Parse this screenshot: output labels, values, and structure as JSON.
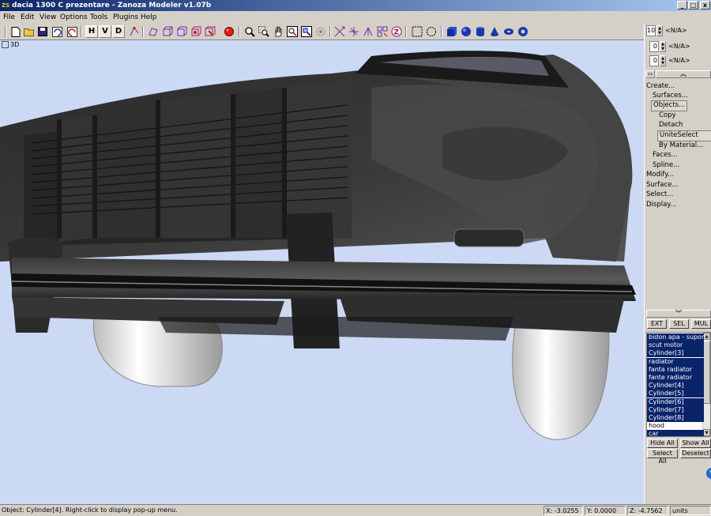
{
  "window": {
    "title": "dacia 1300 C prezentare - Zanoza Modeler v1.07b",
    "logo": "ZS",
    "controls": [
      "_",
      "□",
      "x"
    ]
  },
  "menu": [
    "File",
    "Edit",
    "View",
    "Options",
    "Tools",
    "Plugins",
    "Help"
  ],
  "toolbar": {
    "view_buttons": [
      "H",
      "V",
      "D"
    ]
  },
  "viewport": {
    "label": "3D",
    "background": "#ccd9f4"
  },
  "right_panel": {
    "spinners": [
      {
        "value": "10",
        "label": "<N/A>"
      },
      {
        "value": "0",
        "label": "<N/A>"
      },
      {
        "value": "0",
        "label": "<N/A>"
      }
    ],
    "tree": {
      "create": "Create...",
      "surfaces": "Surfaces...",
      "objects": "Objects...",
      "copy": "Copy",
      "detach": "Detach",
      "unite_select": "UniteSelect",
      "by_material": "By Material...",
      "faces": "Faces...",
      "spline": "Spline...",
      "modify": "Modify...",
      "surface": "Surface...",
      "select": "Select...",
      "display": "Display..."
    },
    "mode_buttons": [
      "EXT",
      "SEL",
      "MUL"
    ],
    "object_list": [
      {
        "name": "bidon apa - suport",
        "selected": true
      },
      {
        "name": "scut motor",
        "selected": true
      },
      {
        "name": "Cylinder[3]",
        "selected": true
      },
      {
        "name": "radiator",
        "selected": true
      },
      {
        "name": "fanta radiator",
        "selected": true
      },
      {
        "name": "fante radiator",
        "selected": true
      },
      {
        "name": "Cylinder[4]",
        "selected": true
      },
      {
        "name": "Cylinder[5]",
        "selected": true
      },
      {
        "name": "Cylinder[6]",
        "selected": true
      },
      {
        "name": "Cylinder[7]",
        "selected": true
      },
      {
        "name": "Cylinder[8]",
        "selected": true
      },
      {
        "name": "hood",
        "selected": false
      },
      {
        "name": "car",
        "selected": true
      }
    ],
    "hide_all": "Hide All",
    "show_all": "Show All",
    "select_all": "Select All",
    "deselect": "Deselect"
  },
  "status": {
    "message": "Object: Cylinder[4]. Right-click to display pop-up menu.",
    "x": "X: -3.0255",
    "y": "Y: 0.0000",
    "z": "Z: -4.7562",
    "units": "units"
  }
}
